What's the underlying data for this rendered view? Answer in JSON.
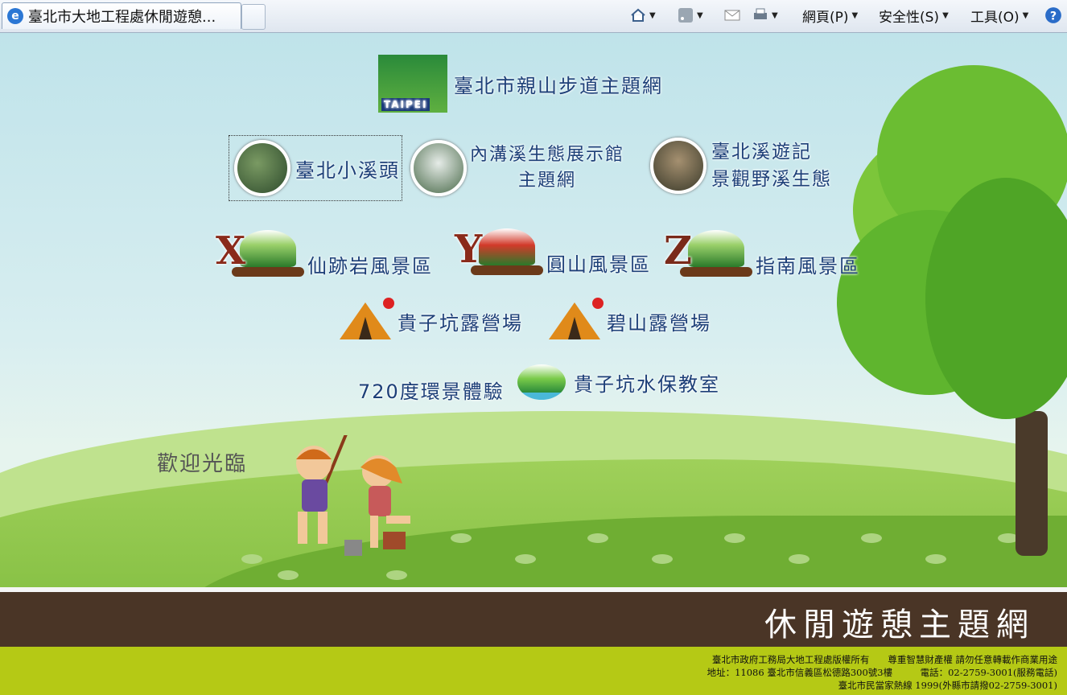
{
  "browser": {
    "tab_title": "臺北市大地工程處休閒遊憩...",
    "menu_page": "網頁(P)",
    "menu_safety": "安全性(S)",
    "menu_tools": "工具(O)"
  },
  "links": {
    "hiking": "臺北市親山步道主題網",
    "hiking_logo_text": "TAIPEI",
    "xiaoxitou": "臺北小溪頭",
    "neigou_line1": "內溝溪生態展示館",
    "neigou_line2": "主題網",
    "creek_line1": "臺北溪遊記",
    "creek_line2": "景觀野溪生態",
    "xianjiyan": "仙跡岩風景區",
    "yuanshan": "圓山風景區",
    "zhinan": "指南風景區",
    "guizikeng_camp": "貴子坑露營場",
    "bishan_camp": "碧山露營場",
    "vr720": "720度環景體驗",
    "classroom": "貴子坑水保教室"
  },
  "welcome": "歡迎光臨",
  "site_title": "休閒遊憩主題網",
  "footer": {
    "line1": "臺北市政府工務局大地工程處版權所有　　尊重智慧財產權 請勿任意轉載作商業用途",
    "line2": "地址：11086 臺北市信義區松德路300號3樓　　　電話：02-2759-3001(服務電話)",
    "line3": "臺北市民當家熱線 1999(外縣市請撥02-2759-3001)"
  },
  "colors": {
    "link_text": "#1d3f78",
    "brown_bar": "#4a3526",
    "green_bar": "#b5c915"
  }
}
